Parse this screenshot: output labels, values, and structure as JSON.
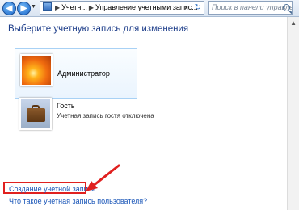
{
  "toolbar": {
    "back_label": "◀",
    "forward_label": "▶",
    "dropdown_label": "▼",
    "breadcrumb": [
      "Учетн...",
      "Управление учетными запис..."
    ],
    "separator": "▶",
    "address_arrow": "▼",
    "refresh_label": "↻",
    "search_placeholder": "Поиск в панели управле..."
  },
  "main": {
    "heading": "Выберите учетную запись для изменения",
    "accounts": [
      {
        "name": "Администратор",
        "status": "",
        "icon": "flower-avatar-icon"
      },
      {
        "name": "Гость",
        "status": "Учетная запись гостя отключена",
        "icon": "briefcase-avatar-icon"
      }
    ],
    "links": {
      "create": "Создание учетной записи",
      "what": "Что такое учетная запись пользователя?"
    }
  },
  "colors": {
    "heading": "#1e3e8a",
    "link": "#1a56b8",
    "highlight": "#e0201f",
    "selected_bg": "#eaf4fe"
  }
}
